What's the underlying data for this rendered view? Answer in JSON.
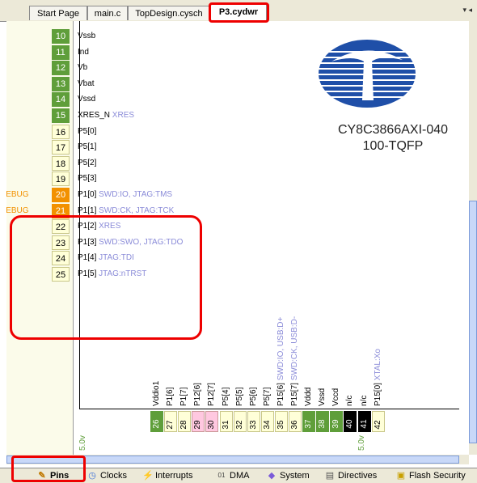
{
  "tabs": [
    {
      "label": "Start Page"
    },
    {
      "label": "main.c"
    },
    {
      "label": "TopDesign.cysch"
    },
    {
      "label": "P3.cydwr"
    }
  ],
  "tab_menu": "▾ ◂",
  "left_pins": [
    {
      "num": "10",
      "label": "Vssb",
      "fn": "",
      "color": "green"
    },
    {
      "num": "11",
      "label": "Ind",
      "fn": "",
      "color": "green"
    },
    {
      "num": "12",
      "label": "Vb",
      "fn": "",
      "color": "green"
    },
    {
      "num": "13",
      "label": "Vbat",
      "fn": "",
      "color": "green"
    },
    {
      "num": "14",
      "label": "Vssd",
      "fn": "",
      "color": "green"
    },
    {
      "num": "15",
      "label": "XRES_N",
      "fn": "XRES",
      "color": "green"
    },
    {
      "num": "16",
      "label": "P5[0]",
      "fn": "",
      "color": "yellow"
    },
    {
      "num": "17",
      "label": "P5[1]",
      "fn": "",
      "color": "yellow"
    },
    {
      "num": "18",
      "label": "P5[2]",
      "fn": "",
      "color": "yellow"
    },
    {
      "num": "19",
      "label": "P5[3]",
      "fn": "",
      "color": "yellow"
    },
    {
      "num": "20",
      "label": "P1[0]",
      "fn": "SWD:IO, JTAG:TMS",
      "color": "orange",
      "debug": "DEBUG"
    },
    {
      "num": "21",
      "label": "P1[1]",
      "fn": "SWD:CK, JTAG:TCK",
      "color": "orange",
      "debug": "DEBUG"
    },
    {
      "num": "22",
      "label": "P1[2]",
      "fn": "XRES",
      "color": "yellow"
    },
    {
      "num": "23",
      "label": "P1[3]",
      "fn": "SWD:SWO, JTAG:TDO",
      "color": "yellow"
    },
    {
      "num": "24",
      "label": "P1[4]",
      "fn": "JTAG:TDI",
      "color": "yellow"
    },
    {
      "num": "25",
      "label": "P1[5]",
      "fn": "JTAG:nTRST",
      "color": "yellow"
    }
  ],
  "bottom_pins": [
    {
      "num": "26",
      "label": "Vddio1",
      "fn": "",
      "color": "green"
    },
    {
      "num": "27",
      "label": "P1[6]",
      "fn": "",
      "color": "yellow"
    },
    {
      "num": "28",
      "label": "P1[7]",
      "fn": "",
      "color": "yellow"
    },
    {
      "num": "29",
      "label": "P12[6]",
      "fn": "",
      "color": "pink"
    },
    {
      "num": "30",
      "label": "P12[7]",
      "fn": "",
      "color": "pink"
    },
    {
      "num": "31",
      "label": "P5[4]",
      "fn": "",
      "color": "yellow"
    },
    {
      "num": "32",
      "label": "P5[5]",
      "fn": "",
      "color": "yellow"
    },
    {
      "num": "33",
      "label": "P5[6]",
      "fn": "",
      "color": "yellow"
    },
    {
      "num": "34",
      "label": "P5[7]",
      "fn": "",
      "color": "yellow"
    },
    {
      "num": "35",
      "label": "P15[6]",
      "fn": "SWD:IO, USB:D+",
      "color": "yellow"
    },
    {
      "num": "36",
      "label": "P15[7]",
      "fn": "SWD:CK, USB:D-",
      "color": "yellow"
    },
    {
      "num": "37",
      "label": "Vddd",
      "fn": "",
      "color": "green"
    },
    {
      "num": "38",
      "label": "Vssd",
      "fn": "",
      "color": "green"
    },
    {
      "num": "39",
      "label": "Vccd",
      "fn": "",
      "color": "green"
    },
    {
      "num": "40",
      "label": "n/c",
      "fn": "",
      "color": "black"
    },
    {
      "num": "41",
      "label": "n/c",
      "fn": "",
      "color": "black"
    },
    {
      "num": "42",
      "label": "P15[0]",
      "fn": "XTAL:Xo",
      "color": "yellow"
    }
  ],
  "voltages": {
    "v26": "5.0v",
    "v37": "5.0v"
  },
  "part_name_1": "CY8C3866AXI-040",
  "part_name_2": "100-TQFP",
  "bottom_tabs": [
    {
      "label": "Pins",
      "icon": "pencil-icon"
    },
    {
      "label": "Clocks",
      "icon": "clock-icon"
    },
    {
      "label": "Interrupts",
      "icon": "lightning-icon"
    },
    {
      "label": "DMA",
      "icon": "binary-icon"
    },
    {
      "label": "System",
      "icon": "system-icon"
    },
    {
      "label": "Directives",
      "icon": "document-icon"
    },
    {
      "label": "Flash Security",
      "icon": "lock-icon"
    }
  ],
  "colors": {
    "green": "#5f9e3a",
    "yellow": "#ffffd8",
    "orange": "#f29100",
    "pink": "#ffc8e0",
    "function_text": "#8a8bd8",
    "highlight": "#e00000"
  }
}
